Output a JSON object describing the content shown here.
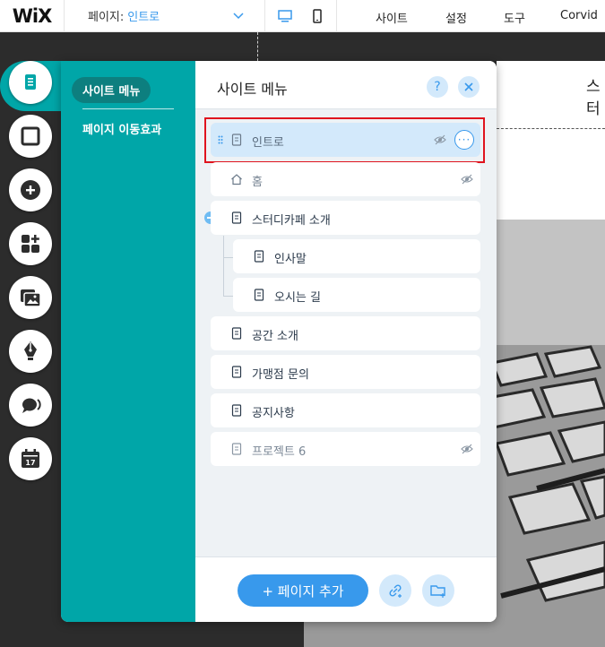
{
  "topbar": {
    "logo": "WiX",
    "page_label": "페이지:",
    "page_value": "인트로",
    "menu": [
      "사이트",
      "설정",
      "도구",
      "Corvid"
    ]
  },
  "canvas": {
    "edge_text": "스터"
  },
  "panel": {
    "nav": {
      "active": "사이트 메뉴",
      "item": "페이지 이동효과"
    },
    "title": "사이트 메뉴",
    "help": "?",
    "pages": [
      {
        "label": "인트로",
        "hidden": true,
        "selected": true
      },
      {
        "label": "홈",
        "hidden": true,
        "home": true
      },
      {
        "label": "스터디카페 소개",
        "hidden": false
      },
      {
        "label": "인사말",
        "hidden": false
      },
      {
        "label": "오시는 길",
        "hidden": false
      },
      {
        "label": "공간 소개",
        "hidden": false
      },
      {
        "label": "가맹점 문의",
        "hidden": false
      },
      {
        "label": "공지사항",
        "hidden": false
      },
      {
        "label": "프로젝트 6",
        "hidden": true
      }
    ],
    "more": "···",
    "add_page": "+ 페이지 추가"
  },
  "colors": {
    "accent": "#3899ec",
    "teal": "#00a6a8",
    "highlight_border": "#e0141e"
  }
}
